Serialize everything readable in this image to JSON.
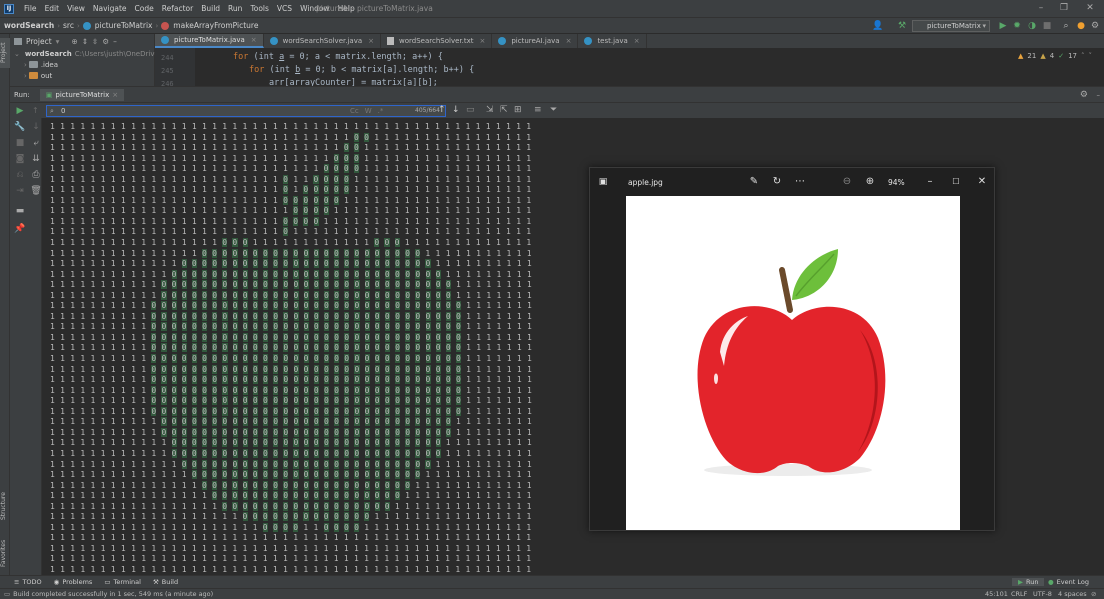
{
  "window": {
    "title": "pictureAI - pictureToMatrix.java"
  },
  "menu": [
    "File",
    "Edit",
    "View",
    "Navigate",
    "Code",
    "Refactor",
    "Build",
    "Run",
    "Tools",
    "VCS",
    "Window",
    "Help"
  ],
  "breadcrumb": {
    "project": "wordSearch",
    "folder": "src",
    "class": "pictureToMatrix",
    "method": "makeArrayFromPicture"
  },
  "run_config": "pictureToMatrix",
  "project_panel": {
    "title": "Project",
    "root_name": "wordSearch",
    "root_path": "C:\\Users\\justh\\OneDrive\\",
    "items": [
      ".idea",
      "out"
    ]
  },
  "editor_tabs": [
    "pictureToMatrix.java",
    "wordSearchSolver.java",
    "wordSearchSolver.txt",
    "pictureAI.java",
    "test.java"
  ],
  "editor": {
    "line_numbers": [
      "244",
      "245",
      "246"
    ],
    "line1_kw": "for",
    "line1_rest": " (int ",
    "line1_var": "a",
    "line1_tail": " = 0; a < matrix.length; a++) {",
    "line2_kw": "for",
    "line2_rest": " (int ",
    "line2_var": "b",
    "line2_tail": " = 0; b < matrix[a].length; b++) {",
    "line3": "arr[arrayCounter] = matrix[a][b];",
    "inspections": {
      "warnings": "21",
      "weak_warnings": "4",
      "ok": "17"
    }
  },
  "run_panel": {
    "label": "Run:",
    "tab": "pictureToMatrix",
    "search_value": "0",
    "match_count": "405/664",
    "options": [
      "Cc",
      "W",
      ".*"
    ]
  },
  "photos": {
    "filename": "apple.jpg",
    "zoom": "94%"
  },
  "left_tabs": [
    "Project",
    "Structure",
    "Favorites"
  ],
  "bottom_tools": [
    "TODO",
    "Problems",
    "Terminal",
    "Build"
  ],
  "bottom_right_tools": [
    "Run",
    "Event Log"
  ],
  "status": {
    "message": "Build completed successfully in 1 sec, 549 ms (a minute ago)",
    "position": "45:101",
    "line_sep": "CRLF",
    "encoding": "UTF-8",
    "indent": "4 spaces"
  },
  "colors": {
    "ide_bg": "#2b2b2b",
    "panel": "#3c3f41",
    "match_highlight": "#32593d",
    "accent": "#4a88c7",
    "apple_red": "#e3242b",
    "leaf_green": "#6dbf3b"
  },
  "matrix_rows": [
    "111111111111111111111111111111111111111111111111",
    "111111111111111111111111111111001111111111111111",
    "111111111111111111111111111110011111111111111111",
    "111111111111111111111111111100011111111111111111",
    "111111111111111111111111111000011111111111111111",
    "111111111111111111111110110000111111111111111111",
    "111111111111111111111110100000111111111111111111",
    "111111111111111111111110000001111111111111111111",
    "111111111111111111111111000011111111111111111111",
    "111111111111111111111110000111111111111111111111",
    "111111111111111111111110111111111111111111111111",
    "111111111111111110001111111111110001111111111111",
    "111111111111111000000000000000000000011111111111",
    "111111111111100000000000000000000000001111111111",
    "111111111111000000000000000000000000000111111111",
    "111111111110000000000000000000000000000011111111",
    "111111111110000000000000000000000000000011111111",
    "111111111100000000000000000000000000000001111111",
    "111111111100000000000000000000000000000001111111",
    "111111111100000000000000000000000000000001111111",
    "111111111100000000000000000000000000000001111111",
    "111111111100000000000000000000000000000001111111",
    "111111111100000000000000000000000000000001111111",
    "111111111100000000000000000000000000000001111111",
    "111111111100000000000000000000000000000001111111",
    "111111111100000000000000000000000000000001111111",
    "111111111100000000000000000000000000000001111111",
    "111111111100000000000000000000000000000001111111",
    "111111111110000000000000000000000000000011111111",
    "111111111110000000000000000000000000000011111111",
    "111111111111000000000000000000000000000111111111",
    "111111111111000000000000000000000000000111111111",
    "111111111111100000000000000000000000001111111111",
    "111111111111110000000000000000000000011111111111",
    "111111111111111000000000000000000000111111111111",
    "111111111111111100000000000000000001111111111111",
    "111111111111111110000000000000000011111111111111",
    "111111111111111111100000000000001111111111111111",
    "111111111111111111111000011000011111111111111111",
    "111111111111111111111111111111111111111111111111",
    "111111111111111111111111111111111111111111111111",
    "111111111111111111111111111111111111111111111111",
    "111111111111111111111111111111111111111111111111"
  ]
}
